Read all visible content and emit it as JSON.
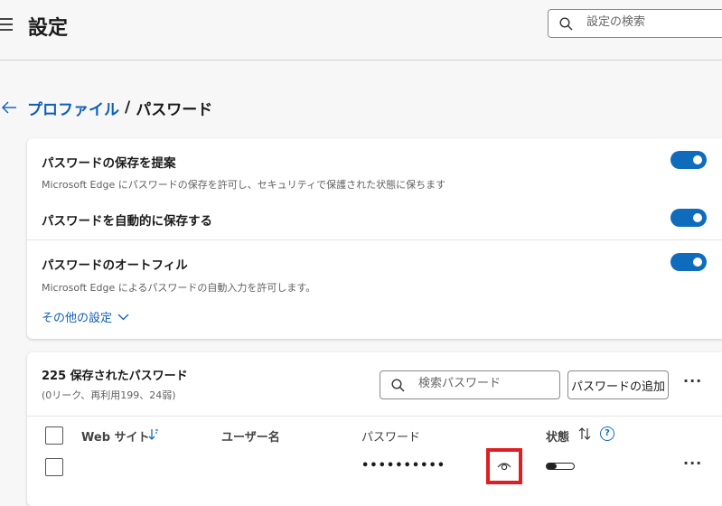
{
  "header": {
    "title": "設定",
    "search_placeholder": "設定の検索"
  },
  "breadcrumb": {
    "parent": "プロファイル",
    "separator": "/",
    "current": "パスワード"
  },
  "settings": [
    {
      "title": "パスワードの保存を提案",
      "description": "Microsoft Edge にパスワードの保存を許可し、セキュリティで保護された状態に保ちます",
      "enabled": true
    },
    {
      "title": "パスワードを自動的に保存する",
      "enabled": true
    },
    {
      "title": "パスワードのオートフィル",
      "description": "Microsoft Edge によるパスワードの自動入力を許可します。",
      "enabled": true
    }
  ],
  "more_settings_label": "その他の設定",
  "passwords": {
    "count_label": "225 保存されたパスワード",
    "sub_label": "(0リーク、再利用199、24弱)",
    "search_placeholder": "検索パスワード",
    "add_button": "パスワードの追加",
    "columns": {
      "website": "Web サイト",
      "username": "ユーザー名",
      "password": "パスワード",
      "status": "状態"
    },
    "rows": [
      {
        "website": "",
        "username": "",
        "password_masked": "••••••••••",
        "strength": 0.35
      }
    ]
  },
  "colors": {
    "accent": "#0f6cbd",
    "link": "#0f5fb8",
    "highlight": "#e11d24"
  }
}
